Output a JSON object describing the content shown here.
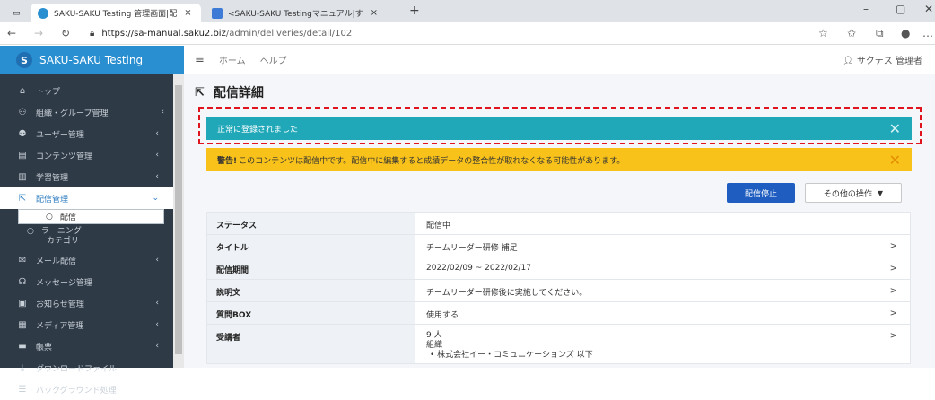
{
  "browser": {
    "tabs": [
      {
        "title": "SAKU-SAKU Testing 管理画面|配",
        "favicon_color": "#2a8fd0"
      },
      {
        "title": "<SAKU-SAKU Testingマニュアル|す",
        "favicon_color": "#3d7bd6"
      }
    ],
    "tab_close": "×",
    "new_tab": "+",
    "url_host": "https://sa-manual.saku2.biz",
    "url_path": "/admin/deliveries/detail/102"
  },
  "sidebar": {
    "brand": "SAKU-SAKU Testing",
    "brand_logo": "S",
    "items": [
      {
        "label": "トップ",
        "icon": "home-icon",
        "glyph": "⌂"
      },
      {
        "label": "組織・グループ管理",
        "icon": "org-icon",
        "glyph": "⚇",
        "chev": "‹"
      },
      {
        "label": "ユーザー管理",
        "icon": "users-icon",
        "glyph": "⚉",
        "chev": "‹"
      },
      {
        "label": "コンテンツ管理",
        "icon": "content-icon",
        "glyph": "▤",
        "chev": "‹"
      },
      {
        "label": "学習管理",
        "icon": "study-icon",
        "glyph": "▥",
        "chev": "‹"
      },
      {
        "label": "配信管理",
        "icon": "delivery-icon",
        "glyph": "⇱",
        "chev": "⌄"
      }
    ],
    "sub_items": [
      {
        "label": "配信",
        "glyph": "○"
      },
      {
        "label": "ラーニング カテゴリ",
        "line1": "ラーニング",
        "line2": "カテゴリ",
        "glyph": "○"
      }
    ],
    "items2": [
      {
        "label": "メール配信",
        "icon": "mail-icon",
        "glyph": "✉",
        "chev": "‹"
      },
      {
        "label": "メッセージ管理",
        "icon": "message-icon",
        "glyph": "☊"
      },
      {
        "label": "お知らせ管理",
        "icon": "notice-icon",
        "glyph": "▣",
        "chev": "‹"
      },
      {
        "label": "メディア管理",
        "icon": "media-icon",
        "glyph": "▦",
        "chev": "‹"
      },
      {
        "label": "帳票",
        "icon": "report-icon",
        "glyph": "▬",
        "chev": "‹"
      },
      {
        "label": "ダウンロードファイル",
        "icon": "download-icon",
        "glyph": "⤓"
      },
      {
        "label": "バックグラウンド処理",
        "icon": "background-icon",
        "glyph": "☰"
      }
    ]
  },
  "topbar": {
    "home": "ホーム",
    "help": "ヘルプ",
    "user": "サクテス 管理者"
  },
  "page": {
    "title": "配信詳細",
    "alert_success": "正常に登録されました",
    "alert_warning_bold": "警告!",
    "alert_warning_text": " このコンテンツは配信中です。配信中に編集すると成績データの整合性が取れなくなる可能性があります。",
    "btn_stop": "配信停止",
    "btn_more": "その他の操作"
  },
  "details": {
    "rows": [
      {
        "key": "ステータス",
        "value": "配信中",
        "arrow": ""
      },
      {
        "key": "タイトル",
        "value": "チームリーダー研修 補足",
        "arrow": ">"
      },
      {
        "key": "配信期間",
        "value": "2022/02/09 ~ 2022/02/17",
        "arrow": ">"
      },
      {
        "key": "説明文",
        "value": "チームリーダー研修後に実施してください。",
        "arrow": ">"
      },
      {
        "key": "質問BOX",
        "value": "使用する",
        "arrow": ">"
      }
    ],
    "recipients": {
      "key": "受講者",
      "count": "9 人",
      "org_label": "組織",
      "org_item": "• 株式会社イー・コミュニケーションズ 以下",
      "arrow": ">"
    }
  },
  "colors": {
    "sidebar_bg": "#2f3a47",
    "brand_bg": "#2a8fd0",
    "success": "#20a8b9",
    "warning": "#f8c21a",
    "primary": "#1f5ec0",
    "highlight": "#e0141e"
  }
}
